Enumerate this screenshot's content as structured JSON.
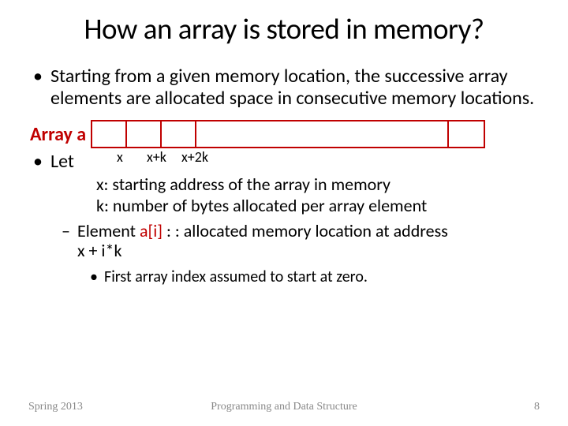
{
  "title": "How an array is stored in memory?",
  "bullet_main": "Starting from a given memory location, the successive array elements are allocated space in consecutive memory locations.",
  "array_label": "Array a",
  "addresses": {
    "a0": "x",
    "a1": "x+k",
    "a2": "x+2k"
  },
  "let_label": "Let",
  "def_x": "x: starting address of the array in memory",
  "def_k": "k: number of bytes allocated per array element",
  "element_prefix": "Element ",
  "element_ai": "a[i]",
  "element_mid": " : : allocated memory location at  address ",
  "element_expr": "x + i*k",
  "sub_bullet": "First array index assumed to start at zero.",
  "footer": {
    "left": "Spring 2013",
    "center": "Programming and Data Structure",
    "right": "8"
  }
}
